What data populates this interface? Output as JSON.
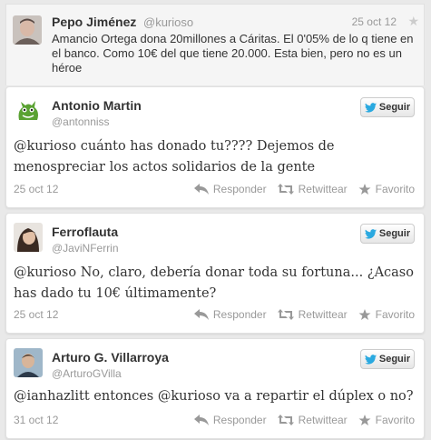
{
  "top_tweet": {
    "name": "Pepo Jiménez",
    "handle": "@kurioso",
    "date": "25 oct 12",
    "text": "Amancio Ortega dona 20millones a Cáritas. El 0'05% de lo q tiene en el banco. Como 10€ del que tiene 20.000. Esta bien, pero no es un héroe"
  },
  "follow_label": "Seguir",
  "actions": {
    "reply": "Responder",
    "retweet": "Retwittear",
    "favorite": "Favorito"
  },
  "replies": [
    {
      "name": "Antonio Martin",
      "handle": "@antonniss",
      "text": "@kurioso cuánto has donado tu???? Dejemos de menospreciar los actos solidarios de la gente",
      "date": "25 oct 12"
    },
    {
      "name": "Ferroflauta",
      "handle": "@JaviNFerrin",
      "text": "@kurioso No, claro, debería donar toda su fortuna... ¿Acaso has dado tu 10€ últimamente?",
      "date": "25 oct 12"
    },
    {
      "name": "Arturo G. Villarroya",
      "handle": "@ArturoGVilla",
      "text": "@ianhazlitt entonces @kurioso va a repartir el dúplex o no?",
      "date": "31 oct 12"
    }
  ],
  "colors": {
    "twitter_blue": "#2aa9e0",
    "muted": "#999999"
  }
}
